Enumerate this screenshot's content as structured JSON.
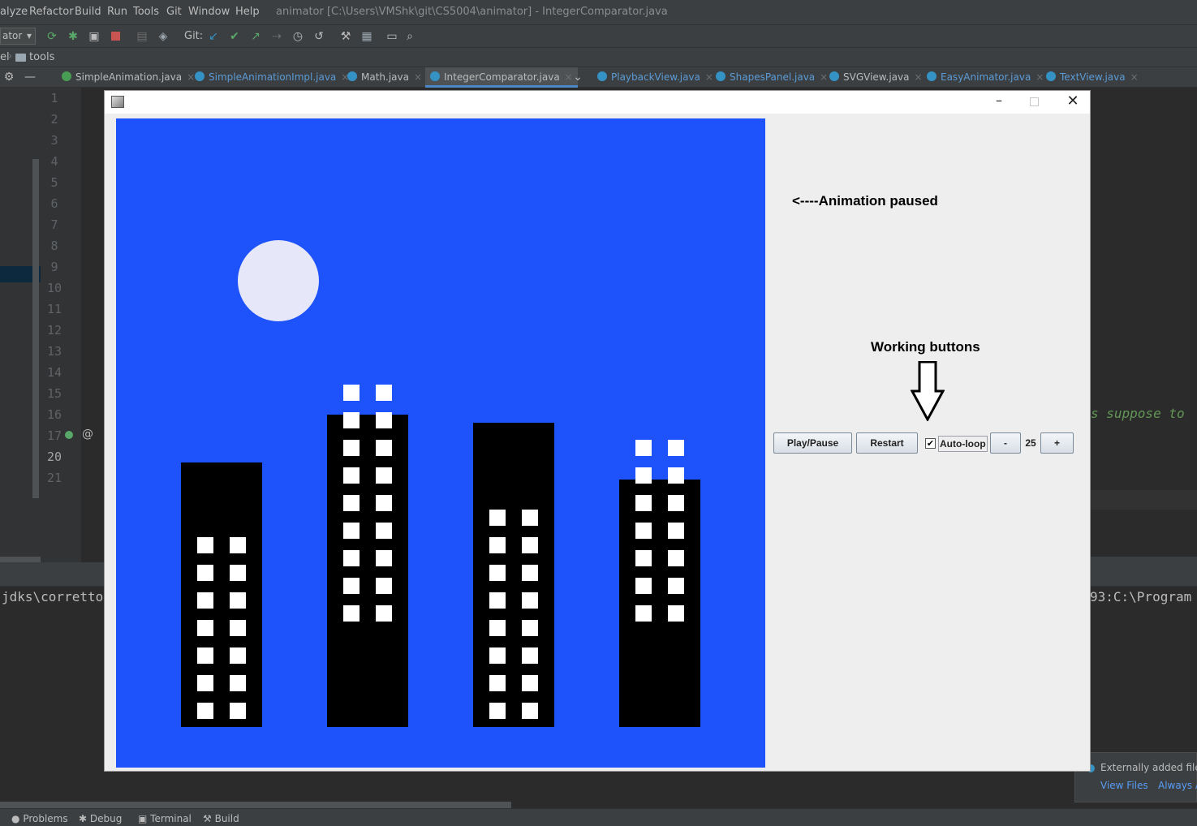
{
  "ide": {
    "menu": [
      "alyze",
      "Refactor",
      "Build",
      "Run",
      "Tools",
      "Git",
      "Window",
      "Help"
    ],
    "title": "animator [C:\\Users\\VMShk\\git\\CS5004\\animator] - IntegerComparator.java",
    "run_config": "ator",
    "git_label": "Git:",
    "breadcrumb_prefix": "el",
    "breadcrumb_folder": "tools",
    "tabs": [
      {
        "label": "SimpleAnimation.java",
        "icon_color": "#499c54",
        "active": false
      },
      {
        "label": "SimpleAnimationImpl.java",
        "icon_color": "#3592c4",
        "active": false
      },
      {
        "label": "Math.java",
        "icon_color": "#3592c4",
        "active": false
      },
      {
        "label": "IntegerComparator.java",
        "icon_color": "#3592c4",
        "active": true
      },
      {
        "label": "PlaybackView.java",
        "icon_color": "#3592c4",
        "active": false
      },
      {
        "label": "ShapesPanel.java",
        "icon_color": "#3592c4",
        "active": false
      },
      {
        "label": "SVGView.java",
        "icon_color": "#3592c4",
        "active": false
      },
      {
        "label": "EasyAnimator.java",
        "icon_color": "#3592c4",
        "active": false
      },
      {
        "label": "TextView.java",
        "icon_color": "#3592c4",
        "active": false
      }
    ],
    "line_numbers": [
      "1",
      "2",
      "3",
      "4",
      "5",
      "6",
      "7",
      "8",
      "9",
      "10",
      "11",
      "12",
      "13",
      "14",
      "15",
      "16",
      "17",
      "20",
      "21"
    ],
    "code_fragment": "s suppose to",
    "console_left": "jdks\\corretto",
    "console_right": "93:C:\\Program",
    "notification": {
      "text": "Externally added files c",
      "link1": "View Files",
      "link2": "Always Ad"
    },
    "status_tabs": [
      "Problems",
      "Debug",
      "Terminal",
      "Build"
    ]
  },
  "app": {
    "annotation_paused": "<----Animation paused",
    "annotation_buttons": "Working buttons",
    "controls": {
      "play_pause": "Play/Pause",
      "restart": "Restart",
      "auto_loop": "Auto-loop",
      "auto_loop_checked": true,
      "minus": "-",
      "speed": "25",
      "plus": "+"
    },
    "scene_colors": {
      "sky": "#1e52fb",
      "moon": "#e6e8fa",
      "building": "#000000",
      "window": "#ffffff"
    }
  }
}
